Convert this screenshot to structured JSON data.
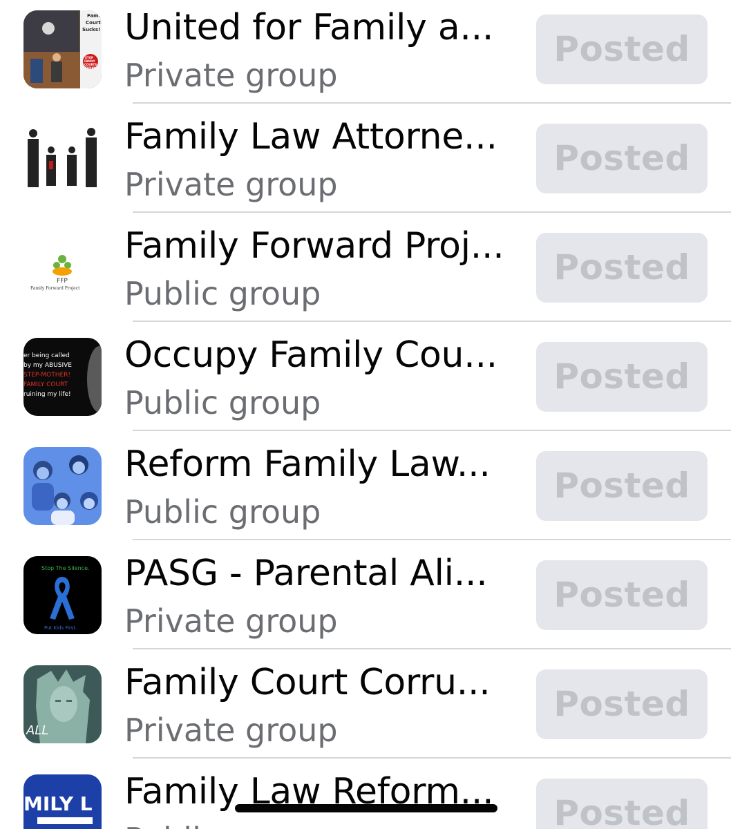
{
  "groups": [
    {
      "name": "United for Family a...",
      "type": "Private group",
      "action": "Posted",
      "thumb_text": [
        "Fami",
        "Court",
        "Sucks!",
        "STOP",
        "FAMILY",
        "COURTS",
        "TODAY"
      ]
    },
    {
      "name": "Family Law Attorne...",
      "type": "Private group",
      "action": "Posted"
    },
    {
      "name": "Family Forward Proj...",
      "type": "Public group",
      "action": "Posted",
      "thumb_text": [
        "FFP",
        "Family Forward Project"
      ]
    },
    {
      "name": "Occupy Family Cou...",
      "type": "Public group",
      "action": "Posted",
      "thumb_text": [
        "er being called",
        "by my ABUSIVE",
        "STEP-MOTHER!",
        "FAMILY COURT",
        "ruining my life!"
      ]
    },
    {
      "name": "Reform Family Law...",
      "type": "Public group",
      "action": "Posted"
    },
    {
      "name": "PASG - Parental Ali...",
      "type": "Private group",
      "action": "Posted",
      "thumb_text": [
        "Stop The Silence.",
        "Put Kids First."
      ]
    },
    {
      "name": "Family Court Corru...",
      "type": "Private group",
      "action": "Posted",
      "thumb_text": [
        "ALL"
      ]
    },
    {
      "name": "Family Law Reform...",
      "type": "Public group",
      "action": "Posted",
      "thumb_text": [
        "MILY L"
      ]
    }
  ],
  "colors": {
    "posted_bg": "#e4e6eb",
    "posted_text": "#bfc2c7",
    "secondary_text": "#6b6d72",
    "divider": "#d4d6da"
  }
}
